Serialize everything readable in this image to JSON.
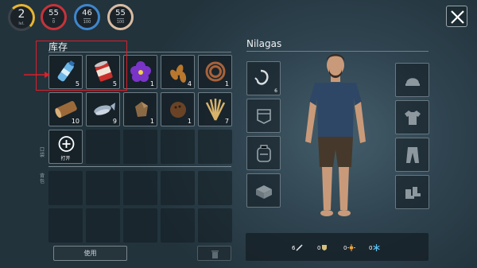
{
  "hud": {
    "level": {
      "value": "2",
      "label": "lvl."
    },
    "health": {
      "value": "55",
      "sub": "0"
    },
    "water": {
      "value": "46",
      "sub": "100"
    },
    "food": {
      "value": "55",
      "sub": "100"
    }
  },
  "inventory": {
    "title": "库存",
    "items": [
      {
        "name": "water-bottle",
        "count": "5"
      },
      {
        "name": "canned-food",
        "count": "5"
      },
      {
        "name": "purple-flower",
        "count": "1"
      },
      {
        "name": "seeds",
        "count": "4"
      },
      {
        "name": "rope",
        "count": "1"
      },
      {
        "name": "wood-log",
        "count": "10"
      },
      {
        "name": "fish",
        "count": "9"
      },
      {
        "name": "stone",
        "count": "1"
      },
      {
        "name": "coconut",
        "count": "1"
      },
      {
        "name": "wheat-bundle",
        "count": "7"
      }
    ],
    "open_label": "打开",
    "pocket_label": "口袋",
    "backpack_label": "背包",
    "use_button": "使用"
  },
  "character": {
    "name": "Nilagas",
    "hook_count": "6",
    "stats": [
      {
        "value": "6",
        "icon": "feather-icon",
        "color": "#dfe6ea"
      },
      {
        "value": "0",
        "icon": "shield-icon",
        "color": "#d8c07a"
      },
      {
        "value": "0",
        "icon": "sun-icon",
        "color": "#f0a33a"
      },
      {
        "value": "0",
        "icon": "snowflake-icon",
        "color": "#5cc0f0"
      }
    ]
  }
}
